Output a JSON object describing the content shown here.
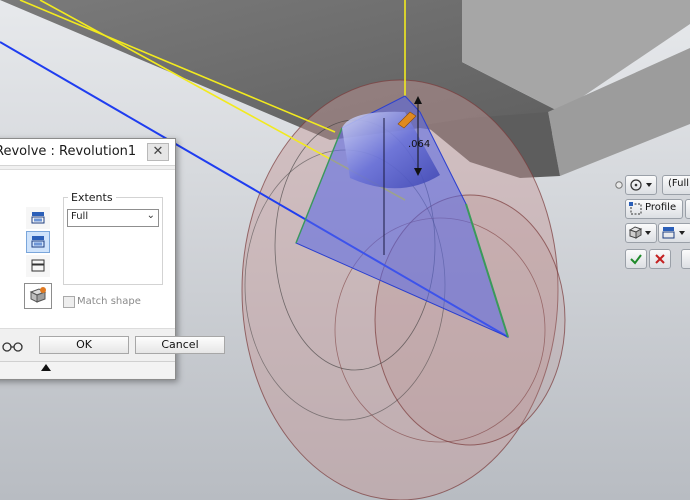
{
  "viewport": {
    "dimension_value": ".064",
    "colors": {
      "background": "#cfd3d8",
      "part_face_dark": "#6e6e6e",
      "part_face_light": "#a9a9a9",
      "sketch_axis": "#1f3df0",
      "sketch_line_yellow": "#f2ea1e",
      "preview_body": "#c69a9a",
      "profile_fill": "#5566e8",
      "edge_green": "#3a9a5a",
      "dimension_handle": "#e08a1e"
    }
  },
  "dialog": {
    "title": "Revolve : Revolution1",
    "extents_label": "Extents",
    "extents_value": "Full",
    "match_shape_label": "Match shape",
    "ok_label": "OK",
    "cancel_label": "Cancel"
  },
  "minitoolbar": {
    "extent_value": "(Full)",
    "profile_label": "Profile"
  }
}
